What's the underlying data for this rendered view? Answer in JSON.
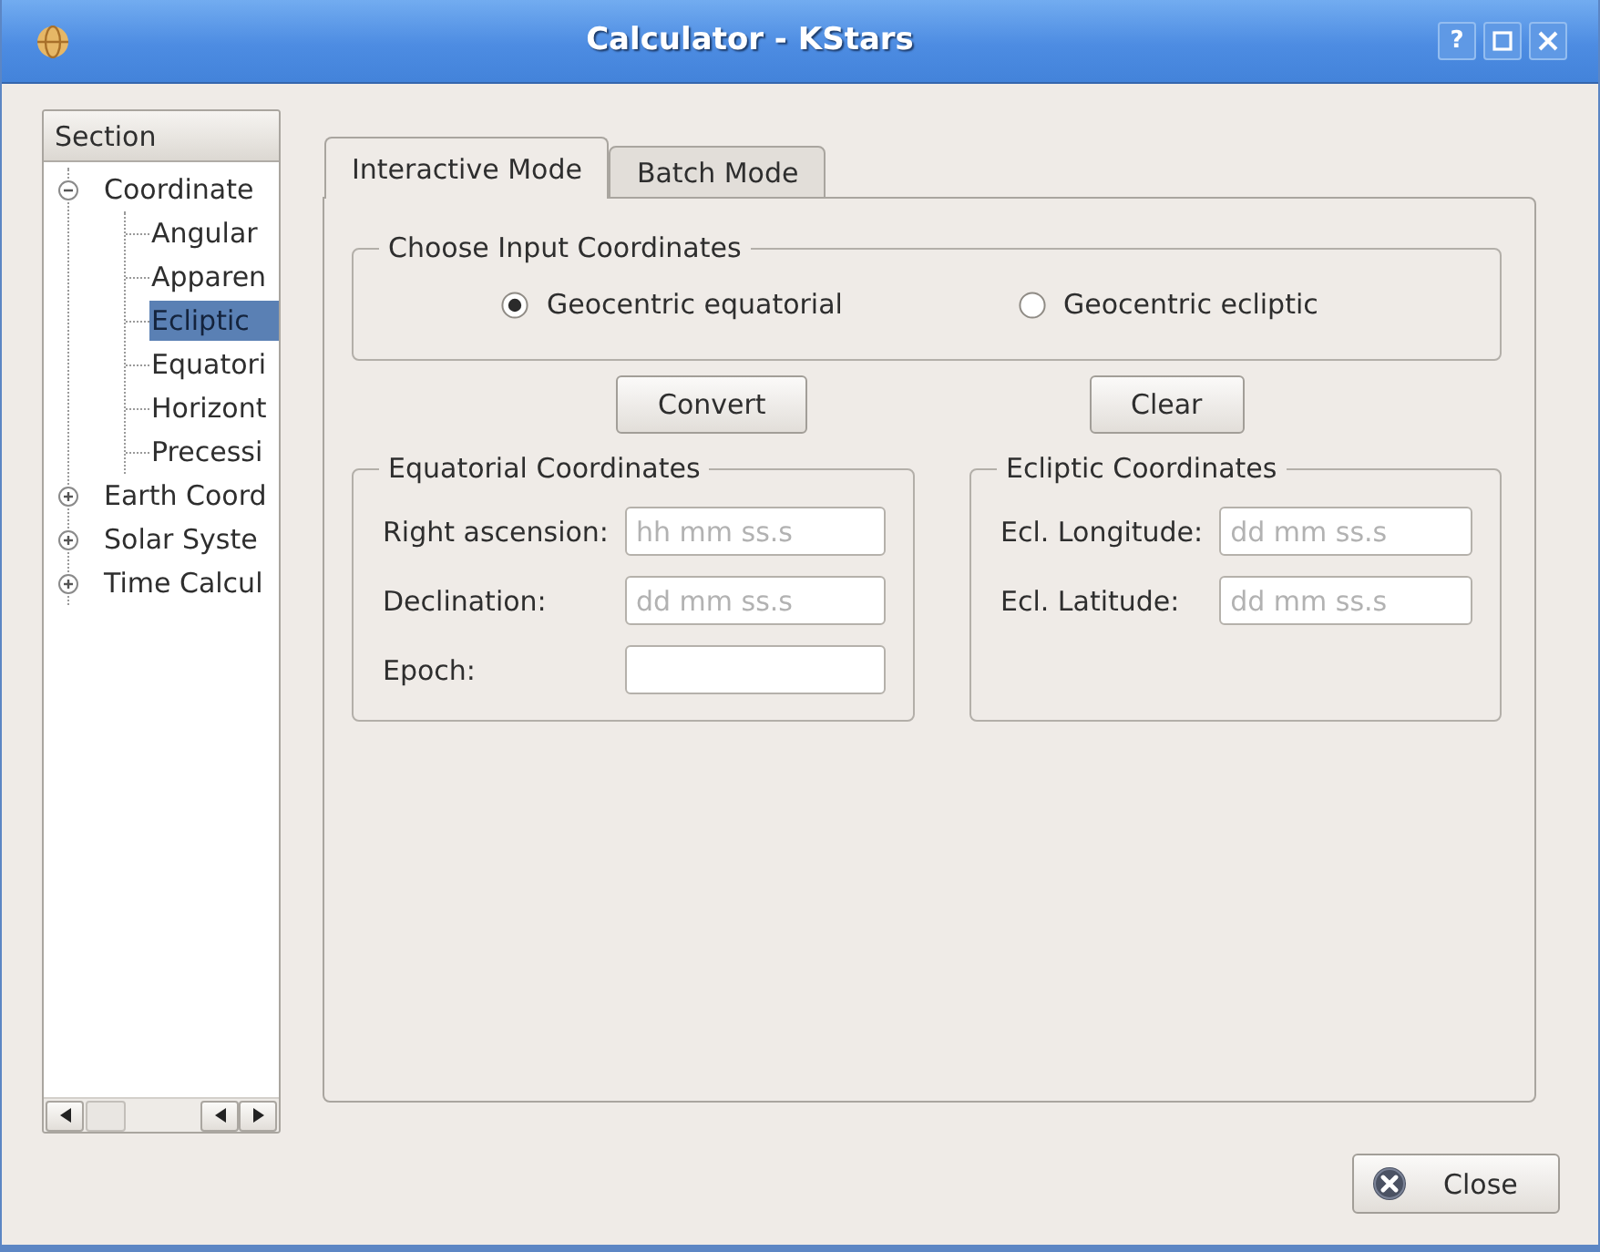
{
  "window": {
    "title": "Calculator - KStars",
    "help_button": "?"
  },
  "sidebar": {
    "header": "Section",
    "items": [
      {
        "label": "Coordinate",
        "expanded": true,
        "selected": false,
        "children": [
          {
            "label": "Angular",
            "selected": false
          },
          {
            "label": "Apparen",
            "selected": false
          },
          {
            "label": "Ecliptic",
            "selected": true
          },
          {
            "label": "Equatori",
            "selected": false
          },
          {
            "label": "Horizont",
            "selected": false
          },
          {
            "label": "Precessi",
            "selected": false
          }
        ]
      },
      {
        "label": "Earth Coord",
        "expanded": false,
        "selected": false
      },
      {
        "label": "Solar Syste",
        "expanded": false,
        "selected": false
      },
      {
        "label": "Time Calcul",
        "expanded": false,
        "selected": false
      }
    ]
  },
  "tabs": [
    {
      "label": "Interactive Mode",
      "selected": true
    },
    {
      "label": "Batch Mode",
      "selected": false
    }
  ],
  "input_coordinates": {
    "title": "Choose Input Coordinates",
    "options": [
      {
        "label": "Geocentric equatorial",
        "selected": true
      },
      {
        "label": "Geocentric ecliptic",
        "selected": false
      }
    ]
  },
  "actions": [
    {
      "label": "Convert"
    },
    {
      "label": "Clear"
    }
  ],
  "coordinate_groups": [
    {
      "title": "Equatorial Coordinates",
      "fields": [
        {
          "label": "Right ascension:",
          "placeholder": "hh mm ss.s"
        },
        {
          "label": "Declination:",
          "placeholder": "dd mm ss.s"
        },
        {
          "label": "Epoch:"
        }
      ]
    },
    {
      "title": "Ecliptic Coordinates",
      "fields": [
        {
          "label": "Ecl. Longitude:",
          "placeholder": "dd mm ss.s"
        },
        {
          "label": "Ecl. Latitude:",
          "placeholder": "dd mm ss.s"
        }
      ]
    }
  ],
  "close_button": {
    "label": "Close"
  }
}
